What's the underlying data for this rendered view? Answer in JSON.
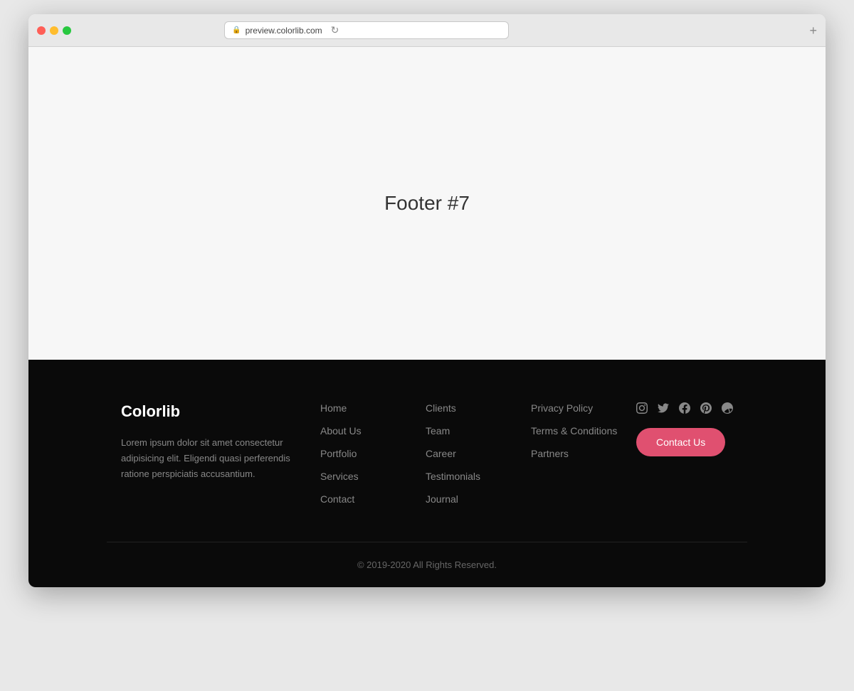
{
  "browser": {
    "url": "preview.colorlib.com",
    "new_tab_label": "+"
  },
  "page": {
    "title": "Footer #7"
  },
  "footer": {
    "brand": {
      "name": "Colorlib",
      "description": "Lorem ipsum dolor sit amet consectetur adipisicing elit. Eligendi quasi perferendis ratione perspiciatis accusantium."
    },
    "col1": {
      "links": [
        "Home",
        "About Us",
        "Portfolio",
        "Services",
        "Contact"
      ]
    },
    "col2": {
      "links": [
        "Clients",
        "Team",
        "Career",
        "Testimonials",
        "Journal"
      ]
    },
    "col3": {
      "links": [
        "Privacy Policy",
        "Terms & Conditions",
        "Partners"
      ]
    },
    "contact_button": "Contact Us",
    "copyright": "© 2019-2020 All Rights Reserved."
  },
  "social": {
    "instagram": "instagram-icon",
    "twitter": "twitter-icon",
    "facebook": "facebook-icon",
    "pinterest": "pinterest-icon",
    "dribbble": "dribbble-icon"
  },
  "colors": {
    "accent": "#e05070",
    "footer_bg": "#0a0a0a",
    "text_muted": "#888888"
  }
}
